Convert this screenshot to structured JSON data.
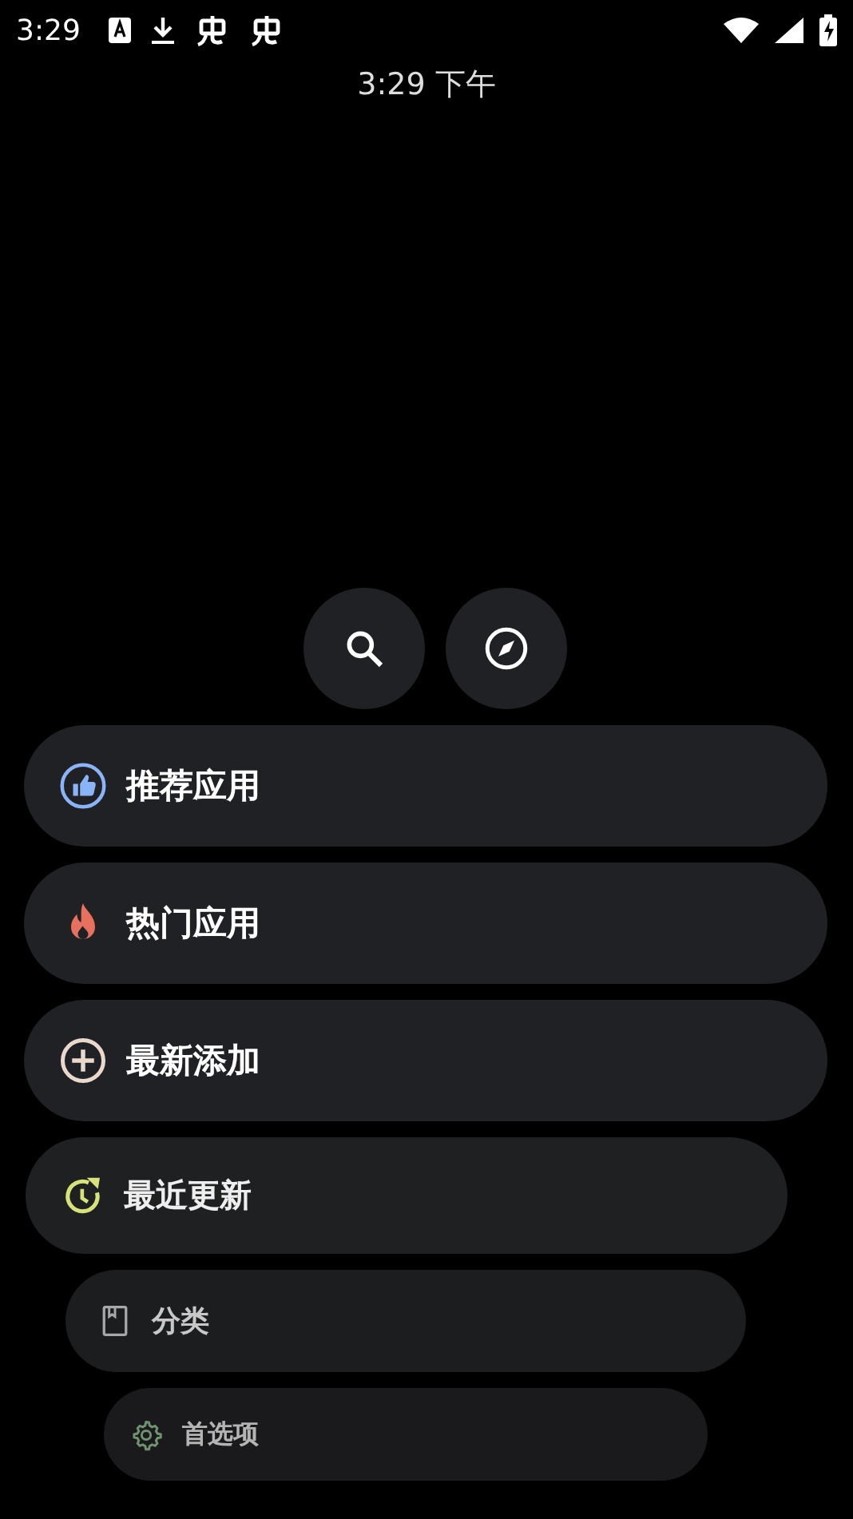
{
  "status_bar": {
    "time": "3:29"
  },
  "clock": "3:29 下午",
  "quick_buttons": [
    {
      "kind": "search"
    },
    {
      "kind": "compass"
    }
  ],
  "menu": [
    {
      "label": "推荐应用",
      "kind": "thumb",
      "color": "#8ab4f8"
    },
    {
      "label": "热门应用",
      "kind": "flame",
      "color": "#e8705f"
    },
    {
      "label": "最新添加",
      "kind": "plus",
      "color": "#ead8cc"
    },
    {
      "label": "最近更新",
      "kind": "history",
      "color": "#d8e27a"
    },
    {
      "label": "分类",
      "kind": "book",
      "color": "#a8a8a8"
    },
    {
      "label": "首选项",
      "kind": "gear",
      "color": "#6f936f"
    }
  ]
}
